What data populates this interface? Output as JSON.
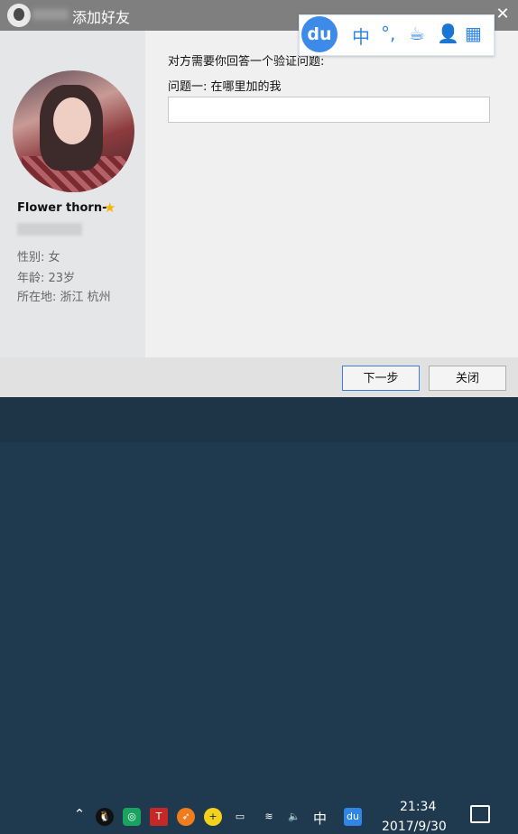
{
  "window": {
    "title": "添加好友"
  },
  "ime": {
    "logo": "du",
    "mode": "中",
    "punct": "°,"
  },
  "profile": {
    "nickname": "Flower thorn-",
    "gender": "性别: 女",
    "age": "年龄: 23岁",
    "location": "所在地: 浙江  杭州"
  },
  "verify": {
    "prompt": "对方需要你回答一个验证问题:",
    "question": "问题一: 在哪里加的我",
    "answer_value": ""
  },
  "buttons": {
    "next": "下一步",
    "close": "关闭"
  },
  "taskbar": {
    "lang": "中",
    "time": "21:34",
    "date": "2017/9/30"
  }
}
